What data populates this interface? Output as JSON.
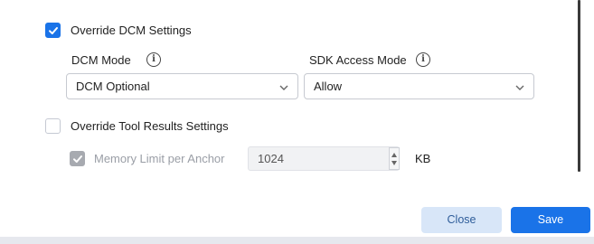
{
  "dcm": {
    "override_label": "Override DCM Settings",
    "override_checked": true,
    "mode_label": "DCM Mode",
    "mode_value": "DCM Optional",
    "sdk_label": "SDK Access Mode",
    "sdk_value": "Allow"
  },
  "tool_results": {
    "override_label": "Override Tool Results Settings",
    "override_checked": false,
    "memory_label": "Memory Limit per Anchor",
    "memory_value": "1024",
    "memory_unit": "KB"
  },
  "footer": {
    "close_label": "Close",
    "save_label": "Save"
  },
  "icons": {
    "info": "info-icon",
    "chevron": "chevron-down-icon",
    "check": "checkmark-icon"
  },
  "colors": {
    "accent": "#1a73e8",
    "secondary_button_bg": "#d8e6f8",
    "disabled_text": "#9a9ea6"
  }
}
